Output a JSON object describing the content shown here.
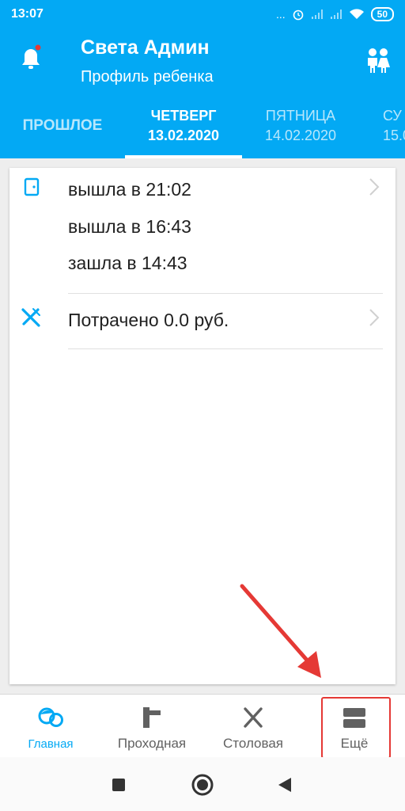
{
  "status_bar": {
    "time": "13:07",
    "dots": "...",
    "battery": "50"
  },
  "header": {
    "user_name": "Света Админ",
    "subtitle": "Профиль ребенка",
    "notification_icon": "bell-icon",
    "profile_switch_icon": "children-icon"
  },
  "tabs": [
    {
      "label": "ПРОШЛОЕ",
      "date": ""
    },
    {
      "label": "ЧЕТВЕРГ",
      "date": "13.02.2020",
      "active": true
    },
    {
      "label": "ПЯТНИЦА",
      "date": "14.02.2020"
    },
    {
      "label": "СУ",
      "date": "15.0"
    }
  ],
  "entries": {
    "passage": [
      "вышла в 21:02",
      "вышла в 16:43",
      "зашла в 14:43"
    ],
    "spent": "Потрачено 0.0 руб."
  },
  "bottom_nav": [
    {
      "label": "Главная",
      "icon": "home-kids-icon",
      "active": true
    },
    {
      "label": "Проходная",
      "icon": "turnstile-icon"
    },
    {
      "label": "Столовая",
      "icon": "cutlery-icon"
    },
    {
      "label": "Ещё",
      "icon": "more-icon"
    }
  ],
  "colors": {
    "primary": "#03a9f4",
    "accent_dot": "#e53935",
    "annotation": "#e53935"
  }
}
